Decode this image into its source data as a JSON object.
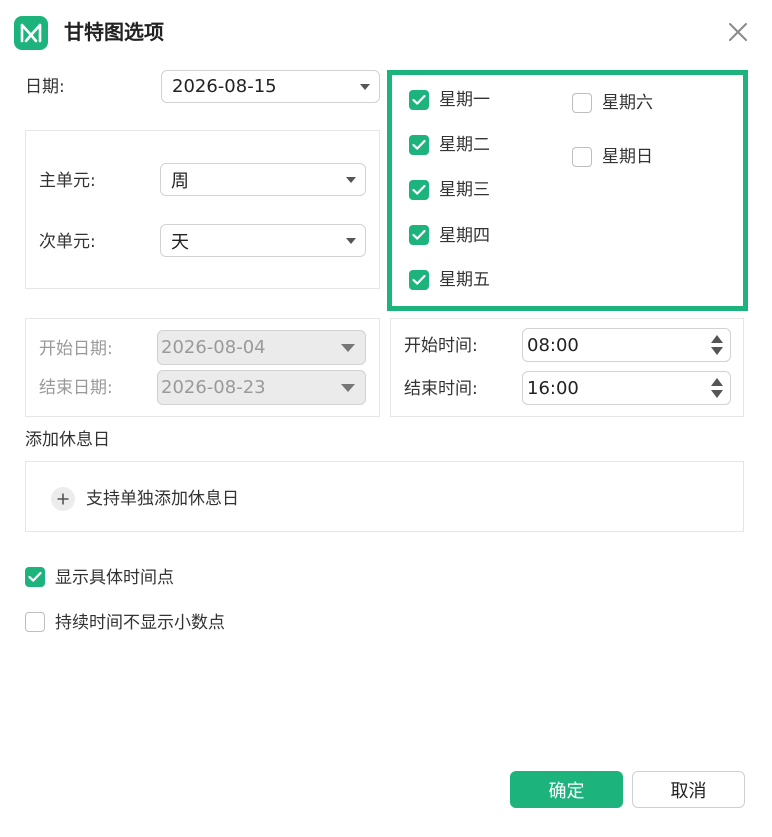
{
  "dialog": {
    "title": "甘特图选项"
  },
  "date": {
    "label": "日期:",
    "value": "2026-08-15"
  },
  "units": {
    "primary_label": "主单元:",
    "primary_value": "周",
    "secondary_label": "次单元:",
    "secondary_value": "天"
  },
  "weekdays": [
    {
      "label": "星期一",
      "checked": true
    },
    {
      "label": "星期二",
      "checked": true
    },
    {
      "label": "星期三",
      "checked": true
    },
    {
      "label": "星期四",
      "checked": true
    },
    {
      "label": "星期五",
      "checked": true
    },
    {
      "label": "星期六",
      "checked": false
    },
    {
      "label": "星期日",
      "checked": false
    }
  ],
  "range": {
    "start_label": "开始日期:",
    "start_value": "2026-08-04",
    "end_label": "结束日期:",
    "end_value": "2026-08-23"
  },
  "time": {
    "start_label": "开始时间:",
    "start_value": "08:00",
    "end_label": "结束时间:",
    "end_value": "16:00"
  },
  "holiday": {
    "section_label": "添加休息日",
    "add_label": "支持单独添加休息日"
  },
  "options": [
    {
      "label": "显示具体时间点",
      "checked": true
    },
    {
      "label": "持续时间不显示小数点",
      "checked": false
    }
  ],
  "buttons": {
    "ok": "确定",
    "cancel": "取消"
  },
  "colors": {
    "accent": "#1db37d"
  }
}
